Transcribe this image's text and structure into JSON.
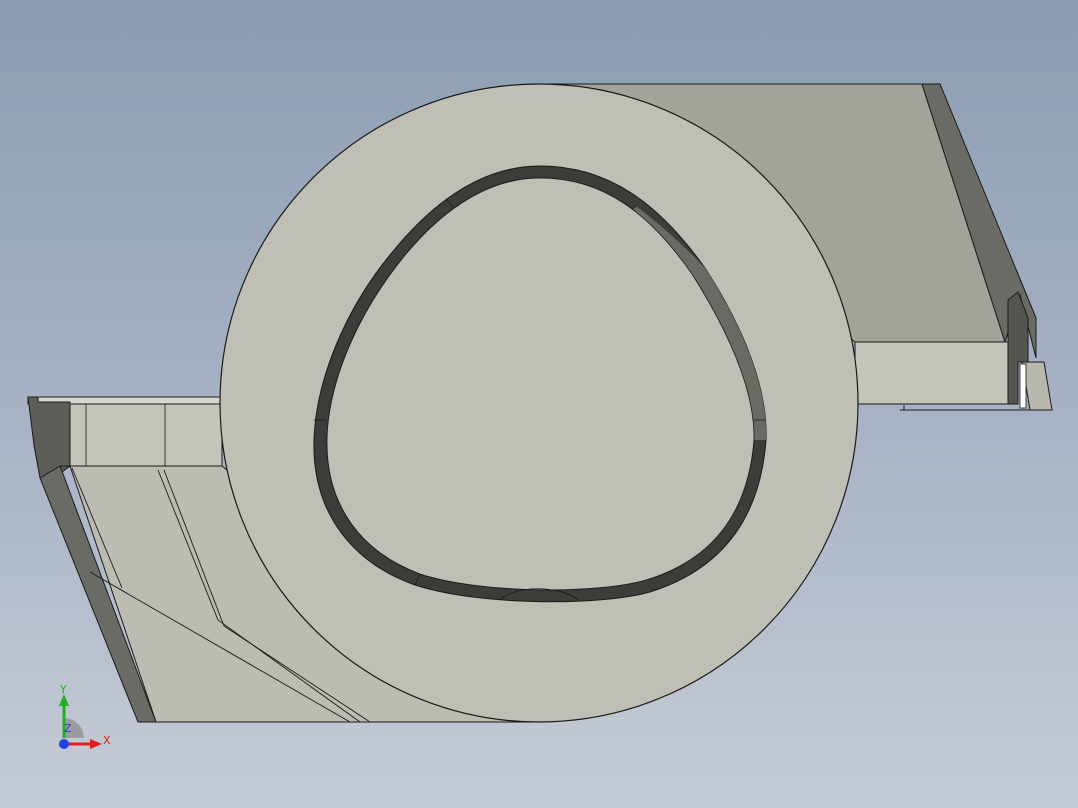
{
  "viewport": {
    "background_top": "#8c9db3",
    "background_bottom": "#c6ccd6"
  },
  "model": {
    "face_color": "#bfbfb5",
    "side_color": "#a3a39a",
    "dark_edge_color": "#5a5a55",
    "outline_color": "#1a1a1a"
  },
  "triad": {
    "x_label": "X",
    "y_label": "Y",
    "z_label": "Z",
    "x_color": "#e02020",
    "y_color": "#20b020",
    "z_color": "#2040e0"
  }
}
